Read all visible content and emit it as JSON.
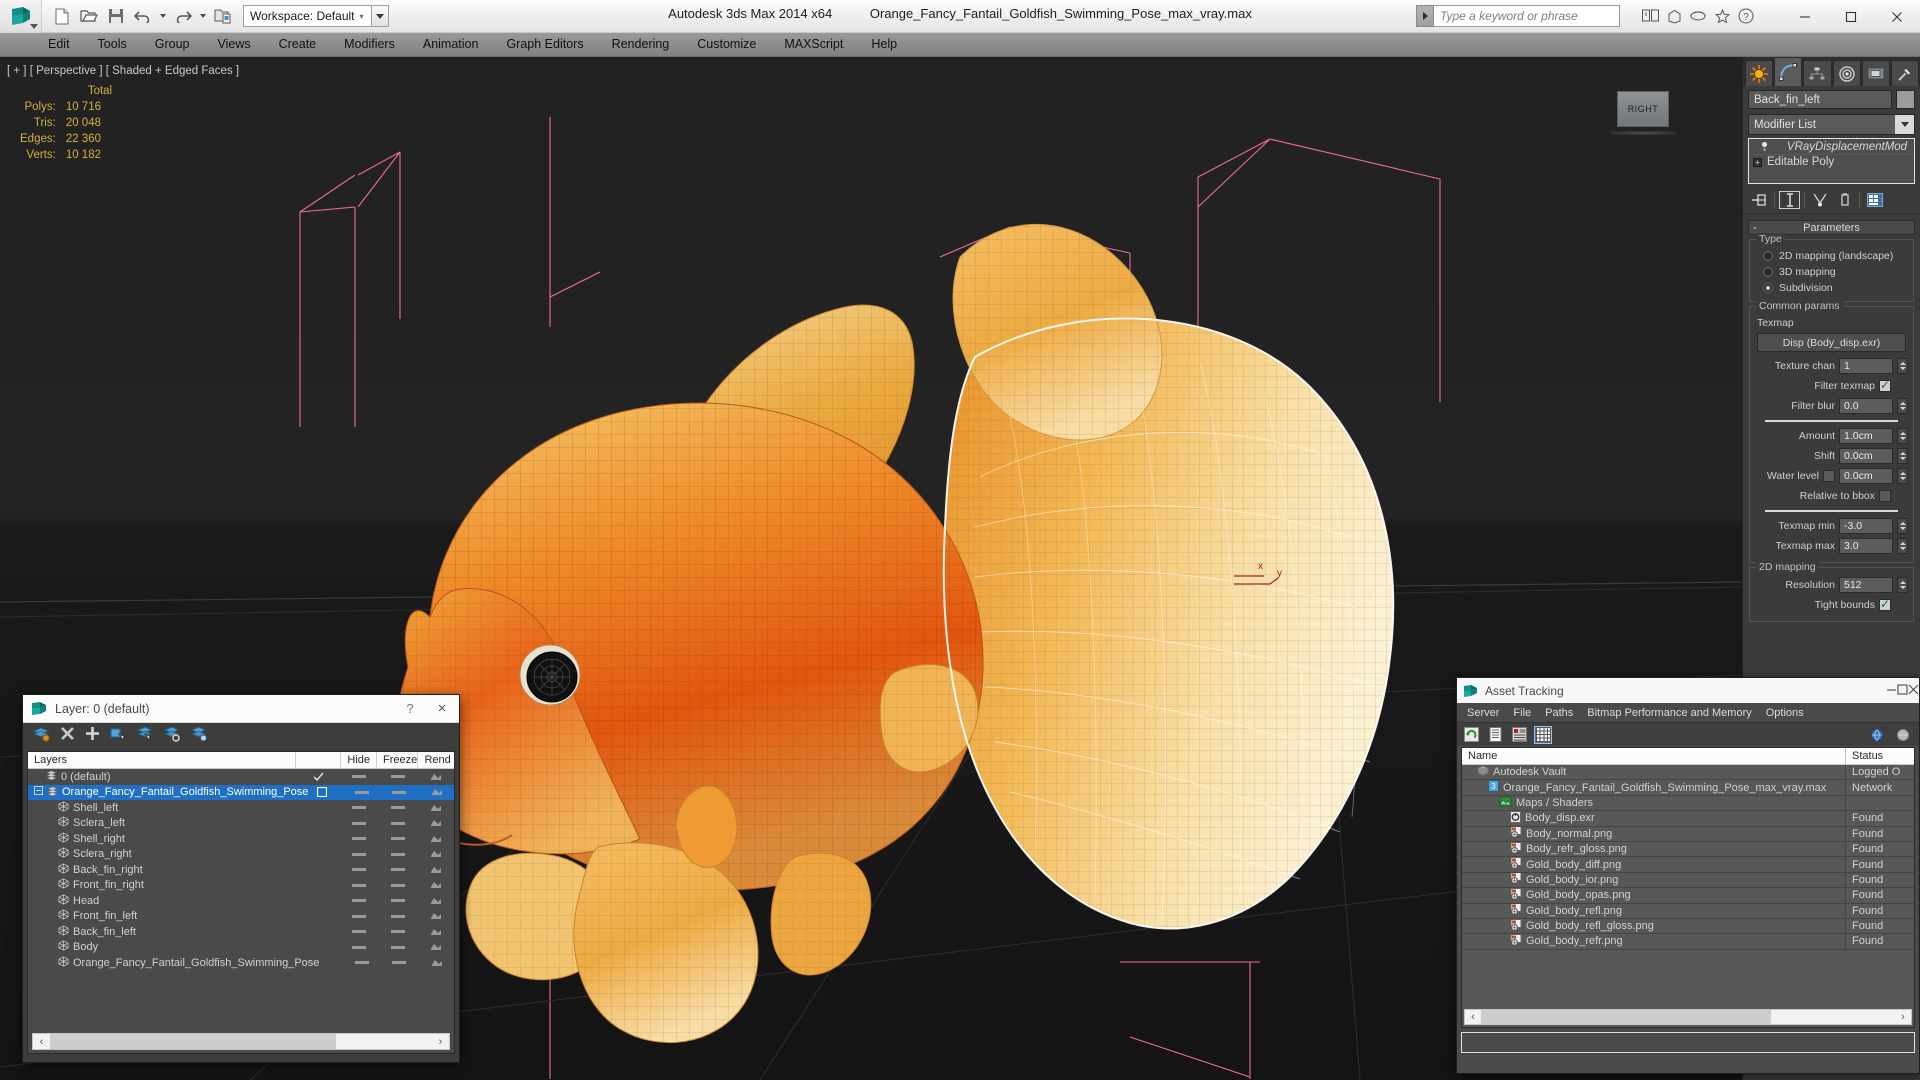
{
  "titlebar": {
    "workspace_label": "Workspace: Default",
    "product": "Autodesk 3ds Max  2014 x64",
    "filename": "Orange_Fancy_Fantail_Goldfish_Swimming_Pose_max_vray.max",
    "search_placeholder": "Type a keyword or phrase",
    "quick_access": [
      {
        "name": "new-file-icon",
        "label": "New"
      },
      {
        "name": "open-file-icon",
        "label": "Open"
      },
      {
        "name": "save-file-icon",
        "label": "Save"
      },
      {
        "name": "undo-icon",
        "label": "Undo"
      },
      {
        "name": "redo-icon",
        "label": "Redo"
      },
      {
        "name": "set-project-folder-icon",
        "label": "Set Project Folder"
      }
    ],
    "window_controls": {
      "minimize": "—",
      "maximize": "□",
      "close": "×"
    }
  },
  "menubar": {
    "items": [
      "Edit",
      "Tools",
      "Group",
      "Views",
      "Create",
      "Modifiers",
      "Animation",
      "Graph Editors",
      "Rendering",
      "Customize",
      "MAXScript",
      "Help"
    ]
  },
  "viewport": {
    "label": "[ + ] [ Perspective ] [ Shaded + Edged Faces ]",
    "stats_header": "Total",
    "stats": [
      {
        "label": "Polys:",
        "value": "10 716"
      },
      {
        "label": "Tris:",
        "value": "20 048"
      },
      {
        "label": "Edges:",
        "value": "22 360"
      },
      {
        "label": "Verts:",
        "value": "10 182"
      }
    ],
    "viewcube_face": "RIGHT",
    "axis_labels": {
      "x": "x",
      "y": "y"
    },
    "colors": {
      "background_top": "#222222",
      "background_bottom": "#141414",
      "helper_pink": "#f06a9c",
      "axis_red": "#b02020",
      "stats_yellow": "#d3b13a",
      "fish_orange": "#e8631a",
      "fish_gold": "#f0a93c",
      "fin_cream": "#f7e3b4"
    }
  },
  "command_panel": {
    "tabs": [
      {
        "name": "create-tab",
        "icon": "star-icon"
      },
      {
        "name": "modify-tab",
        "icon": "curve-icon",
        "active": true
      },
      {
        "name": "hierarchy-tab",
        "icon": "hierarchy-icon"
      },
      {
        "name": "motion-tab",
        "icon": "motion-icon"
      },
      {
        "name": "display-tab",
        "icon": "display-icon"
      },
      {
        "name": "utilities-tab",
        "icon": "hammer-icon"
      }
    ],
    "object_name": "Back_fin_left",
    "modifier_list_label": "Modifier List",
    "stack": [
      {
        "label": "VRayDisplacementMod",
        "italic": true
      },
      {
        "label": "Editable Poly",
        "italic": false
      }
    ],
    "stack_buttons": [
      {
        "name": "pin-stack-button",
        "icon": "pin-icon"
      },
      {
        "name": "show-end-result-button",
        "icon": "show-end-result-icon"
      },
      {
        "name": "make-unique-button",
        "icon": "make-unique-icon"
      },
      {
        "name": "remove-modifier-button",
        "icon": "trash-icon"
      },
      {
        "name": "configure-modifier-sets-button",
        "icon": "config-sets-icon"
      }
    ],
    "rollout": {
      "title": "Parameters",
      "collapse_glyph": "-",
      "type_group": {
        "title": "Type",
        "options": [
          {
            "label": "2D mapping (landscape)",
            "selected": false
          },
          {
            "label": "3D mapping",
            "selected": false
          },
          {
            "label": "Subdivision",
            "selected": true
          }
        ]
      },
      "common_group": {
        "title": "Common params",
        "texmap_label": "Texmap",
        "texmap_button": "Disp (Body_disp.exr)",
        "fields": [
          {
            "label": "Texture chan",
            "value": "1",
            "spinner": true
          },
          {
            "label": "Filter texmap",
            "checkbox": true,
            "checked": true
          },
          {
            "label": "Filter blur",
            "value": "0.0",
            "spinner": true
          },
          {
            "label": "Amount",
            "value": "1.0cm",
            "spinner": true
          },
          {
            "label": "Shift",
            "value": "0.0cm",
            "spinner": true
          },
          {
            "label": "Water level",
            "value": "0.0cm",
            "spinner": true,
            "checkbox": true,
            "checked": false
          },
          {
            "label": "Relative to bbox",
            "checkbox": true,
            "checked": false
          },
          {
            "label": "Texmap min",
            "value": "-3.0",
            "spinner": true
          },
          {
            "label": "Texmap max",
            "value": "3.0",
            "spinner": true
          }
        ]
      },
      "mapping_group": {
        "title": "2D mapping",
        "fields": [
          {
            "label": "Resolution",
            "value": "512",
            "spinner": true
          },
          {
            "label": "Tight bounds",
            "checkbox": true,
            "checked": true
          }
        ]
      }
    }
  },
  "layer_dialog": {
    "title": "Layer: 0 (default)",
    "help_glyph": "?",
    "close_glyph": "×",
    "toolbar": [
      {
        "name": "create-new-layer-icon"
      },
      {
        "name": "delete-layer-icon"
      },
      {
        "name": "add-selection-to-layer-icon"
      },
      {
        "name": "select-objects-in-layer-icon"
      },
      {
        "name": "highlight-selected-objects-icon"
      },
      {
        "name": "hide-unhide-layer-icon"
      },
      {
        "name": "layer-properties-icon"
      }
    ],
    "columns": [
      "Layers",
      "",
      "Hide",
      "Freeze",
      "Rend"
    ],
    "rows": [
      {
        "name": "0 (default)",
        "indent": 1,
        "type": "layer",
        "checked": true,
        "selected": false,
        "expander": false
      },
      {
        "name": "Orange_Fancy_Fantail_Goldfish_Swimming_Pose",
        "indent": 0,
        "type": "layer",
        "checked": false,
        "selected": true,
        "expander": true
      },
      {
        "name": "Shell_left",
        "indent": 2,
        "type": "mesh",
        "selected": false
      },
      {
        "name": "Sclera_left",
        "indent": 2,
        "type": "mesh",
        "selected": false
      },
      {
        "name": "Shell_right",
        "indent": 2,
        "type": "mesh",
        "selected": false
      },
      {
        "name": "Sclera_right",
        "indent": 2,
        "type": "mesh",
        "selected": false
      },
      {
        "name": "Back_fin_right",
        "indent": 2,
        "type": "mesh",
        "selected": false
      },
      {
        "name": "Front_fin_right",
        "indent": 2,
        "type": "mesh",
        "selected": false
      },
      {
        "name": "Head",
        "indent": 2,
        "type": "mesh",
        "selected": false
      },
      {
        "name": "Front_fin_left",
        "indent": 2,
        "type": "mesh",
        "selected": false
      },
      {
        "name": "Back_fin_left",
        "indent": 2,
        "type": "mesh",
        "selected": false
      },
      {
        "name": "Body",
        "indent": 2,
        "type": "mesh",
        "selected": false
      },
      {
        "name": "Orange_Fancy_Fantail_Goldfish_Swimming_Pose",
        "indent": 2,
        "type": "mesh",
        "selected": false
      }
    ],
    "scroll_left_glyph": "‹",
    "scroll_right_glyph": "›"
  },
  "asset_tracking": {
    "title": "Asset Tracking",
    "window_controls": {
      "minimize": "—",
      "maximize": "□",
      "close": "×"
    },
    "menu": [
      "Server",
      "File",
      "Paths",
      "Bitmap Performance and Memory",
      "Options"
    ],
    "toolbar": [
      {
        "name": "refresh-icon",
        "active": false
      },
      {
        "name": "list-view-icon",
        "active": false
      },
      {
        "name": "detail-view-icon",
        "active": false
      },
      {
        "name": "grid-view-icon",
        "active": true
      }
    ],
    "toolbar_right": [
      {
        "name": "help-globe-icon"
      },
      {
        "name": "help-icon"
      }
    ],
    "columns": [
      "Name",
      "Status"
    ],
    "rows": [
      {
        "name": "Autodesk Vault",
        "status": "Logged O",
        "indent": 1,
        "icon": "vault-icon"
      },
      {
        "name": "Orange_Fancy_Fantail_Goldfish_Swimming_Pose_max_vray.max",
        "status": "Network",
        "indent": 2,
        "icon": "max-file-icon"
      },
      {
        "name": "Maps / Shaders",
        "status": "",
        "indent": 3,
        "icon": "maps-icon"
      },
      {
        "name": "Body_disp.exr",
        "status": "Found",
        "indent": 4,
        "icon": "exr-icon"
      },
      {
        "name": "Body_normal.png",
        "status": "Found",
        "indent": 4,
        "icon": "png-icon"
      },
      {
        "name": "Body_refr_gloss.png",
        "status": "Found",
        "indent": 4,
        "icon": "png-icon"
      },
      {
        "name": "Gold_body_diff.png",
        "status": "Found",
        "indent": 4,
        "icon": "png-icon"
      },
      {
        "name": "Gold_body_ior.png",
        "status": "Found",
        "indent": 4,
        "icon": "png-icon"
      },
      {
        "name": "Gold_body_opas.png",
        "status": "Found",
        "indent": 4,
        "icon": "png-icon"
      },
      {
        "name": "Gold_body_refl.png",
        "status": "Found",
        "indent": 4,
        "icon": "png-icon"
      },
      {
        "name": "Gold_body_refl_gloss.png",
        "status": "Found",
        "indent": 4,
        "icon": "png-icon"
      },
      {
        "name": "Gold_body_refr.png",
        "status": "Found",
        "indent": 4,
        "icon": "png-icon"
      }
    ],
    "scroll_left_glyph": "‹",
    "scroll_right_glyph": "›"
  }
}
